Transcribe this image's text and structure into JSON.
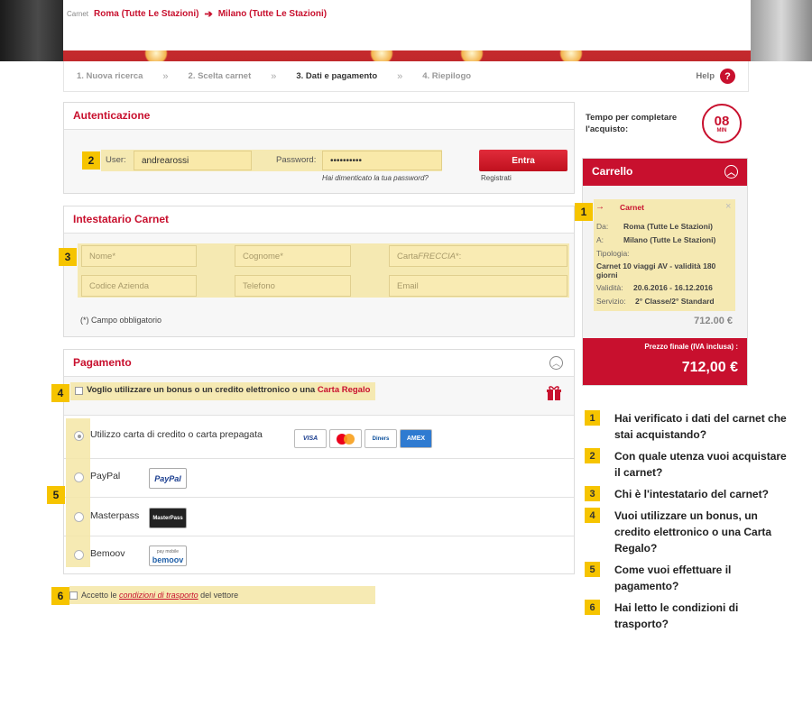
{
  "route": {
    "label": "Carnet",
    "from": "Roma (Tutte Le Stazioni)",
    "arrow": "➔",
    "to": "Milano (Tutte Le Stazioni)"
  },
  "steps": [
    {
      "label": "1. Nuova ricerca",
      "active": false
    },
    {
      "label": "2. Scelta carnet",
      "active": false
    },
    {
      "label": "3. Dati e pagamento",
      "active": true
    },
    {
      "label": "4. Riepilogo",
      "active": false
    }
  ],
  "step_separator": "»",
  "help": {
    "label": "Help",
    "icon": "?"
  },
  "auth": {
    "title": "Autenticazione",
    "user_label": "User:",
    "user_value": "andrearossi",
    "password_label": "Password:",
    "password_value": "••••••••••",
    "forgot": "Hai dimenticato la tua password?",
    "login_button": "Entra",
    "register": "Registrati"
  },
  "holder": {
    "title": "Intestatario Carnet",
    "fields": {
      "nome": "Nome*",
      "cognome": "Cognome*",
      "carta_prefix": "Carta",
      "carta_italic": "FRECCIA",
      "carta_suffix": "*:",
      "codice_azienda": "Codice Azienda",
      "telefono": "Telefono",
      "email": "Email"
    },
    "required_note": "(*) Campo obbligatorio"
  },
  "payment": {
    "title": "Pagamento",
    "bonus_text": "Voglio utilizzare un bonus o un credito elettronico o una",
    "bonus_link": "Carta Regalo",
    "methods": [
      {
        "label": "Utilizzo carta di credito o carta prepagata",
        "selected": true
      },
      {
        "label": "PayPal",
        "selected": false
      },
      {
        "label": "Masterpass",
        "selected": false
      },
      {
        "label": "Bemoov",
        "selected": false
      }
    ],
    "cards": [
      "VISA",
      "MC",
      "Diners",
      "AMEX"
    ],
    "paypal_logo": "PayPal",
    "masterpass_logo": "MasterPass",
    "bemoov_top": "pay mobile",
    "bemoov_logo": "bemoov"
  },
  "terms": {
    "prefix": "Accetto le",
    "link": "condizioni di trasporto",
    "suffix": "del vettore"
  },
  "timer": {
    "text": "Tempo per completare l'acquisto:",
    "value": "08",
    "unit": "MIN"
  },
  "cart": {
    "title": "Carrello",
    "item_title": "Carnet",
    "close": "×",
    "da_label": "Da:",
    "da_value": "Roma (Tutte Le Stazioni)",
    "a_label": "A:",
    "a_value": "Milano (Tutte Le Stazioni)",
    "tipologia_label": "Tipologia:",
    "tipologia_value": "Carnet 10 viaggi AV - validità 180 giorni",
    "validita_label": "Validità:",
    "validita_value": "20.6.2016 - 16.12.2016",
    "servizio_label": "Servizio:",
    "servizio_value": "2° Classe/2° Standard",
    "subtotal": "712.00 €",
    "total_label": "Prezzo finale (IVA inclusa) :",
    "total_value": "712,00 €"
  },
  "questions": [
    {
      "n": "1",
      "text": "Hai verificato i dati del carnet che stai acquistando?"
    },
    {
      "n": "2",
      "text": "Con quale utenza vuoi acquistare il carnet?"
    },
    {
      "n": "3",
      "text": "Chi è l'intestatario del carnet?"
    },
    {
      "n": "4",
      "text": "Vuoi utilizzare un bonus, un credito elettronico o una Carta Regalo?"
    },
    {
      "n": "5",
      "text": "Come vuoi effettuare il pagamento?"
    },
    {
      "n": "6",
      "text": "Hai letto le condizioni di trasporto?"
    }
  ],
  "colors": {
    "accent": "#c8102e",
    "highlight": "#f5e6a6",
    "marker": "#f6c400"
  }
}
